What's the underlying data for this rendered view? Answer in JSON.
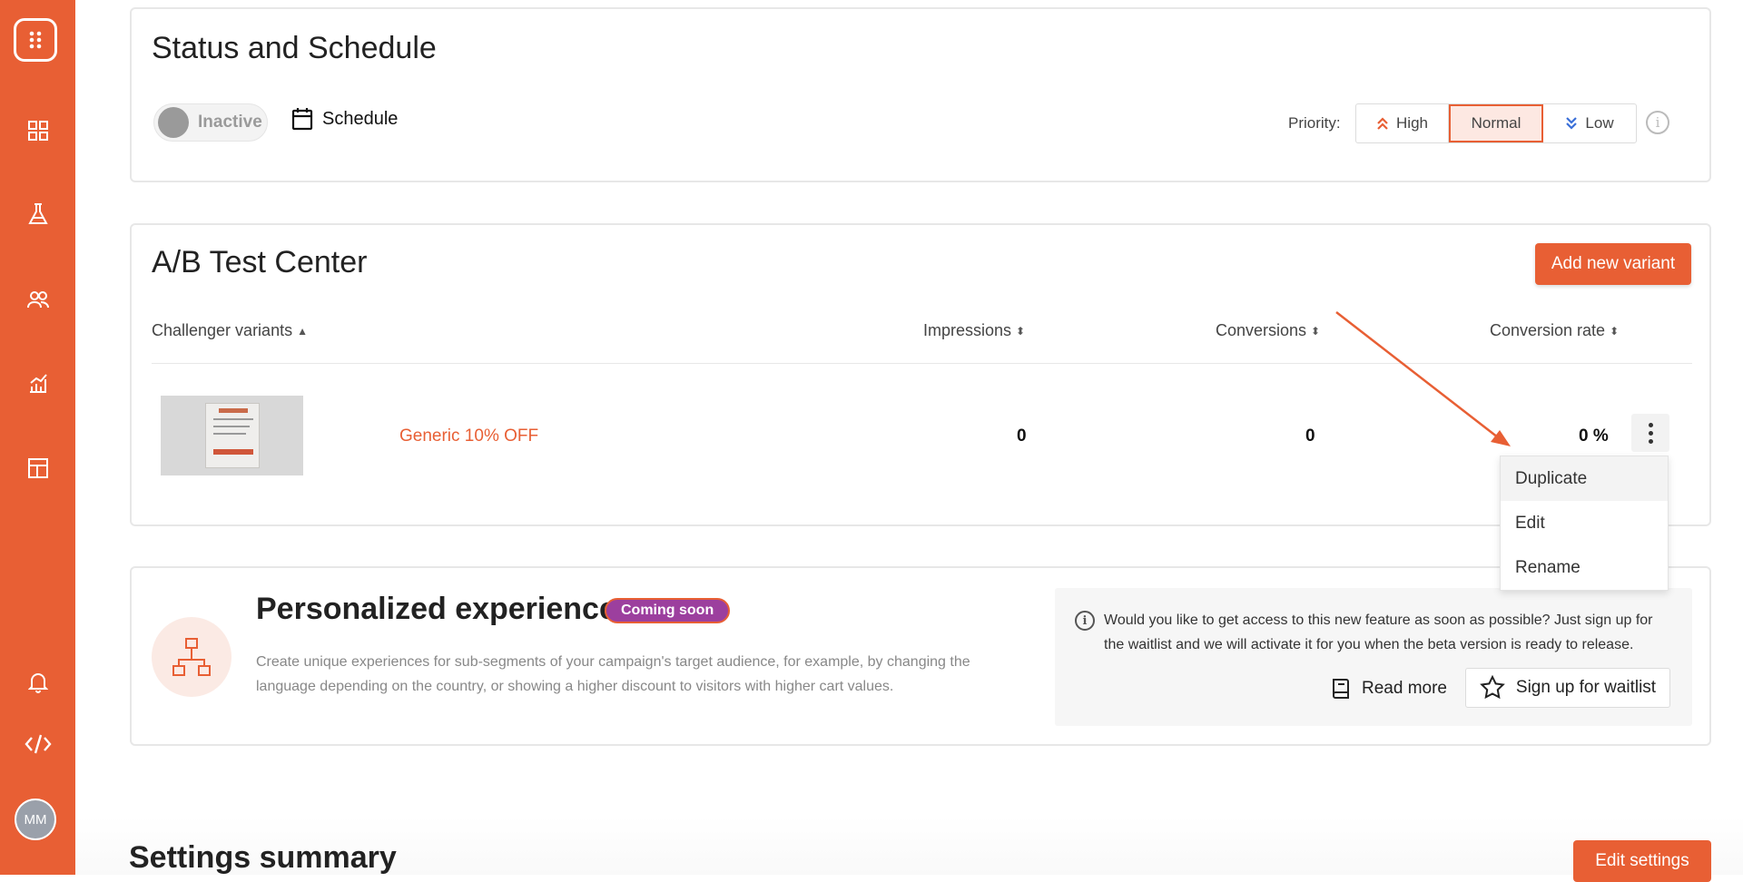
{
  "sidebar": {
    "avatar_initials": "MM",
    "items": [
      "dashboard-icon",
      "flask-icon",
      "users-icon",
      "analytics-icon",
      "layout-icon"
    ],
    "bottom_items": [
      "bell-icon",
      "code-icon"
    ]
  },
  "status": {
    "title": "Status and Schedule",
    "toggle_label": "Inactive",
    "schedule_label": "Schedule",
    "priority_label": "Priority:",
    "priorities": [
      {
        "label": "High",
        "active": false
      },
      {
        "label": "Normal",
        "active": true
      },
      {
        "label": "Low",
        "active": false
      }
    ]
  },
  "ab_test": {
    "title": "A/B Test Center",
    "add_button": "Add new variant",
    "columns": [
      "Challenger variants",
      "Impressions",
      "Conversions",
      "Conversion rate"
    ],
    "rows": [
      {
        "name": "Generic 10% OFF",
        "impressions": "0",
        "conversions": "0",
        "conversion_rate": "0 %"
      }
    ],
    "menu": [
      "Duplicate",
      "Edit",
      "Rename"
    ]
  },
  "personalized": {
    "title": "Personalized experiences",
    "badge": "Coming soon",
    "description": "Create unique experiences for sub-segments of your campaign's target audience, for example, by changing the language depending on the country, or showing a higher discount to visitors with higher cart values.",
    "panel_text": "Would you like to get access to this new feature as soon as possible? Just sign up for the waitlist and we will activate it for you when the beta version is ready to release.",
    "read_more": "Read more",
    "waitlist": "Sign up for waitlist"
  },
  "settings": {
    "title": "Settings summary",
    "edit_button": "Edit settings"
  },
  "colors": {
    "brand": "#e85f34",
    "badge": "#9c3f9e"
  }
}
